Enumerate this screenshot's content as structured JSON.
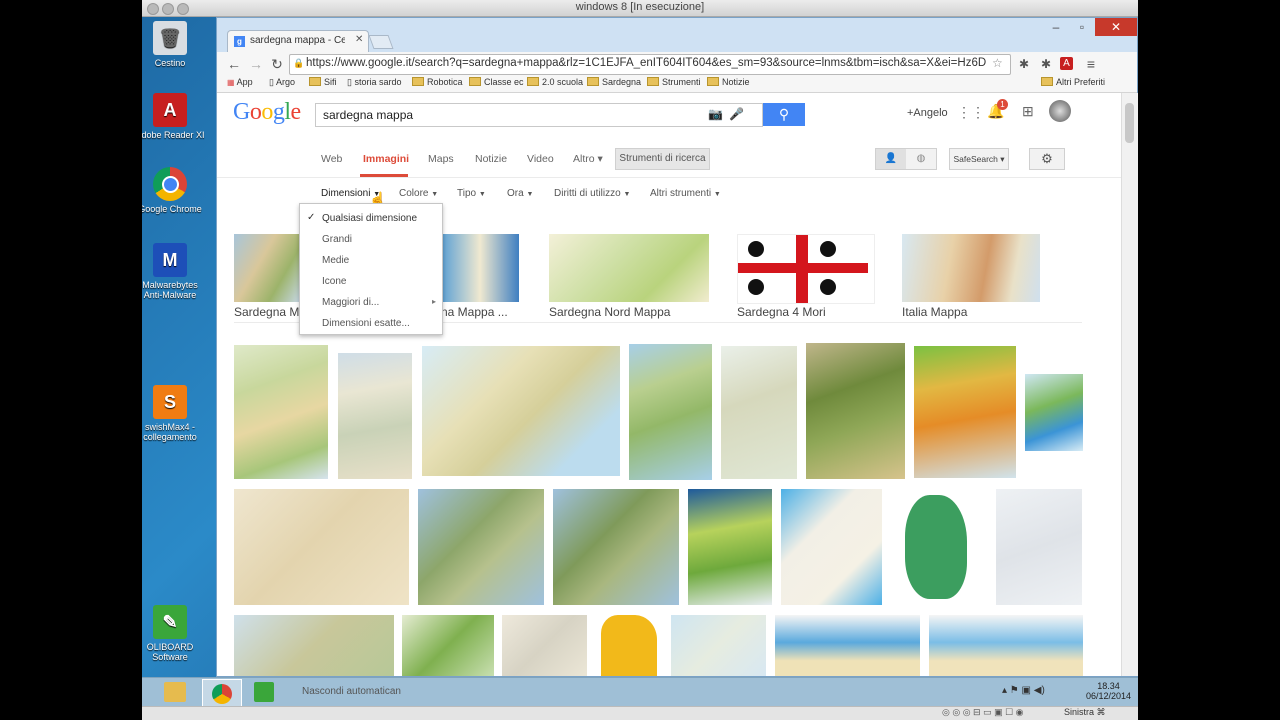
{
  "vm": {
    "title": "windows 8 [In esecuzione]",
    "status_key": "Sinistra ⌘"
  },
  "desktop_icons": [
    {
      "label": "Cestino",
      "icon": "recycle-bin-icon"
    },
    {
      "label": "Adobe Reader XI",
      "icon": "pdf-icon"
    },
    {
      "label": "Google Chrome",
      "icon": "chrome-icon"
    },
    {
      "label": "Malwarebytes Anti-Malware",
      "icon": "shield-icon"
    },
    {
      "label": "swishMax4 - collegamento",
      "icon": "swish-icon"
    },
    {
      "label": "OLIBOARD Software",
      "icon": "board-icon"
    }
  ],
  "browser": {
    "tab_title": "sardegna mappa - Cerca c...",
    "url": "https://www.google.it/search?q=sardegna+mappa&rlz=1C1EJFA_enIT604IT604&es_sm=93&source=lnms&tbm=isch&sa=X&ei=Hz6DV",
    "bookmarks": [
      "App",
      "Argo",
      "Sifi",
      "storia sardo",
      "Robotica",
      "Classe ec",
      "2.0 scuola",
      "Sardegna",
      "Strumenti",
      "Notizie"
    ],
    "other_bookmarks": "Altri Preferiti"
  },
  "google": {
    "logo": "Google",
    "query": "sardegna mappa",
    "user": "+Angelo",
    "notif_count": "1",
    "tabs": [
      "Web",
      "Immagini",
      "Maps",
      "Notizie",
      "Video",
      "Altro ▾"
    ],
    "tools_button": "Strumenti di ricerca",
    "safesearch": "SafeSearch ▾",
    "filters": [
      "Dimensioni",
      "Colore",
      "Tipo",
      "Ora",
      "Diritti di utilizzo",
      "Altri strumenti"
    ],
    "size_menu": [
      "Qualsiasi dimensione",
      "Grandi",
      "Medie",
      "Icone",
      "Maggiori di...",
      "Dimensioni esatte..."
    ],
    "related": [
      "Sardegna M",
      "na Mappa ...",
      "Sardegna Nord Mappa",
      "Sardegna 4 Mori",
      "Italia Mappa"
    ]
  },
  "taskbar": {
    "autohide": "Nascondi automatican",
    "time": "18.34",
    "date": "06/12/2014"
  },
  "colors": {
    "google_blue": "#4285f4",
    "google_red": "#dd4b39",
    "map_green": "#8fae5e"
  }
}
